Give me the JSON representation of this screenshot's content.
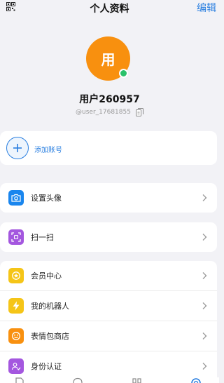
{
  "header": {
    "title": "个人资料",
    "edit_label": "编辑",
    "qr_icon": "qr-code-icon"
  },
  "profile": {
    "avatar_char": "用",
    "avatar_color": "#f8900f",
    "online_color": "#2bc26b",
    "name": "用户260957",
    "user_id": "@user_17681855",
    "copy_icon": "copy-icon"
  },
  "add_account": {
    "label": "添加账号",
    "icon": "plus-icon",
    "accent": "#2a7fe0"
  },
  "menu": {
    "set_avatar": {
      "label": "设置头像",
      "icon": "camera-icon",
      "color": "#1a86ee"
    },
    "scan": {
      "label": "扫一扫",
      "icon": "scan-icon",
      "color": "#a457df"
    },
    "member": {
      "label": "会员中心",
      "icon": "star-badge-icon",
      "color": "#f5c518"
    },
    "robots": {
      "label": "我的机器人",
      "icon": "lightning-icon",
      "color": "#f5c518"
    },
    "stickers": {
      "label": "表情包商店",
      "icon": "smiley-icon",
      "color": "#f8900f"
    },
    "identity": {
      "label": "身份认证",
      "icon": "identity-icon",
      "color": "#a457df"
    }
  },
  "bottom_nav": {
    "items": [
      "document-icon",
      "chat-bubble-icon",
      "contacts-icon",
      "settings-gear-icon"
    ],
    "active_color": "#2a7fe0"
  }
}
